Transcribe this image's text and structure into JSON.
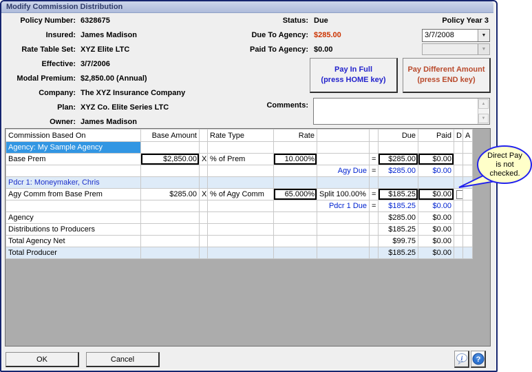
{
  "window": {
    "title": "Modify Commission Distribution"
  },
  "info": {
    "left": [
      {
        "label": "Policy Number:",
        "value": "6328675"
      },
      {
        "label": "Insured:",
        "value": "James Madison"
      },
      {
        "label": "Rate Table Set:",
        "value": "XYZ Elite LTC"
      },
      {
        "label": "Effective:",
        "value": "3/7/2006"
      },
      {
        "label": "Modal Premium:",
        "value": "$2,850.00 (Annual)"
      },
      {
        "label": "Company:",
        "value": "The XYZ Insurance Company"
      },
      {
        "label": "Plan:",
        "value": "XYZ Co. Elite Series LTC"
      },
      {
        "label": "Owner:",
        "value": "James Madison"
      }
    ],
    "right": [
      {
        "label": "Status:",
        "value": "Due"
      },
      {
        "label": "Due To Agency:",
        "value": "$285.00"
      },
      {
        "label": "Paid To Agency:",
        "value": "$0.00"
      }
    ],
    "policy_year": "Policy Year 3",
    "date_value": "3/7/2008",
    "secondary_combo_value": "",
    "comments_label": "Comments:",
    "comments_value": ""
  },
  "actions": {
    "pay_full_line1": "Pay In Full",
    "pay_full_line2": "(press HOME key)",
    "pay_diff_line1": "Pay Different Amount",
    "pay_diff_line2": "(press END key)"
  },
  "table": {
    "header": [
      "Commission Based On",
      "Base Amount",
      "",
      "Rate Type",
      "Rate",
      "",
      "",
      "Due",
      "Paid",
      "D",
      "A"
    ],
    "rows": [
      {
        "cls": "",
        "cells": [
          {
            "t": "Agency: My Sample Agency",
            "cls": "selhdr"
          },
          {},
          {},
          {},
          {},
          {},
          {},
          {},
          {},
          {},
          {}
        ]
      },
      {
        "cls": "",
        "cells": [
          {
            "t": "Base Prem"
          },
          {
            "t": "$2,850.00",
            "cls": "boxed",
            "input": true
          },
          {
            "t": "X"
          },
          {
            "t": "% of Prem"
          },
          {
            "t": "10.000%",
            "cls": "boxed",
            "input": true
          },
          {},
          {
            "t": "="
          },
          {
            "t": "$285.00",
            "cls": "boxed",
            "input": true
          },
          {
            "t": "$0.00",
            "cls": "boxed",
            "input": true
          },
          {},
          {}
        ]
      },
      {
        "cls": "",
        "cells": [
          {},
          {},
          {},
          {},
          {},
          {
            "t": "Agy Due",
            "cls": "blue"
          },
          {
            "t": "="
          },
          {
            "t": "$285.00",
            "cls": "blue"
          },
          {
            "t": "$0.00",
            "cls": "blue"
          },
          {},
          {}
        ]
      },
      {
        "cls": "ltblue",
        "cells": [
          {
            "t": "Pdcr 1: Moneymaker, Chris",
            "cls": "bluebold"
          },
          {},
          {},
          {},
          {},
          {},
          {},
          {},
          {},
          {},
          {}
        ]
      },
      {
        "cls": "",
        "cells": [
          {
            "t": "Agy Comm from Base Prem"
          },
          {
            "t": "$285.00"
          },
          {
            "t": "X"
          },
          {
            "t": "% of Agy Comm"
          },
          {
            "t": "65.000%",
            "cls": "boxed",
            "input": true
          },
          {
            "t": "Split 100.00%",
            "cls": "left"
          },
          {
            "t": "="
          },
          {
            "t": "$185.25",
            "cls": "boxed",
            "input": true
          },
          {
            "t": "$0.00",
            "cls": "boxed",
            "input": true
          },
          {
            "checkbox": true
          },
          {}
        ]
      },
      {
        "cls": "",
        "cells": [
          {},
          {},
          {},
          {},
          {},
          {
            "t": "Pdcr 1 Due",
            "cls": "blue"
          },
          {
            "t": "="
          },
          {
            "t": "$185.25",
            "cls": "blue"
          },
          {
            "t": "$0.00",
            "cls": "blue"
          },
          {},
          {}
        ]
      },
      {
        "cls": "",
        "cells": [
          {
            "t": "Agency",
            "cls": "bold"
          },
          {},
          {},
          {},
          {},
          {},
          {},
          {
            "t": "$285.00",
            "cls": "bold"
          },
          {
            "t": "$0.00",
            "cls": "bold"
          },
          {},
          {}
        ]
      },
      {
        "cls": "",
        "cells": [
          {
            "t": "Distributions to Producers",
            "cls": "indent"
          },
          {},
          {},
          {},
          {},
          {},
          {},
          {
            "t": "$185.25"
          },
          {
            "t": "$0.00"
          },
          {},
          {}
        ]
      },
      {
        "cls": "",
        "cells": [
          {
            "t": "Total Agency Net",
            "cls": "bold"
          },
          {},
          {},
          {},
          {},
          {},
          {},
          {
            "t": "$99.75",
            "cls": "bold"
          },
          {
            "t": "$0.00",
            "cls": "bold"
          },
          {},
          {}
        ]
      },
      {
        "cls": "ltblue",
        "cells": [
          {
            "t": "Total Producer",
            "cls": "bold"
          },
          {},
          {},
          {},
          {},
          {},
          {},
          {
            "t": "$185.25",
            "cls": "bold"
          },
          {
            "t": "$0.00",
            "cls": "bold"
          },
          {},
          {}
        ]
      }
    ]
  },
  "callout": {
    "line1": "Direct Pay",
    "line2": "is not",
    "line3": "checked."
  },
  "footer": {
    "ok": "OK",
    "cancel": "Cancel"
  },
  "icons": {
    "up": "▲",
    "down": "▼",
    "dropdown": "▼",
    "info": "i",
    "help": "?"
  },
  "colors": {
    "due_amount_red": "#CC3300",
    "table_blue": "#0023D0",
    "selected_agency_blue": "#3296E3",
    "row_highlight": "#DEEBF8",
    "callout_fill": "#FFFFC9",
    "callout_border": "#2222EE",
    "pay_full_blue": "#2222CC",
    "pay_diff_red": "#B94A2C",
    "titlebar": "#B7C3DF",
    "window_border": "#16256E"
  }
}
